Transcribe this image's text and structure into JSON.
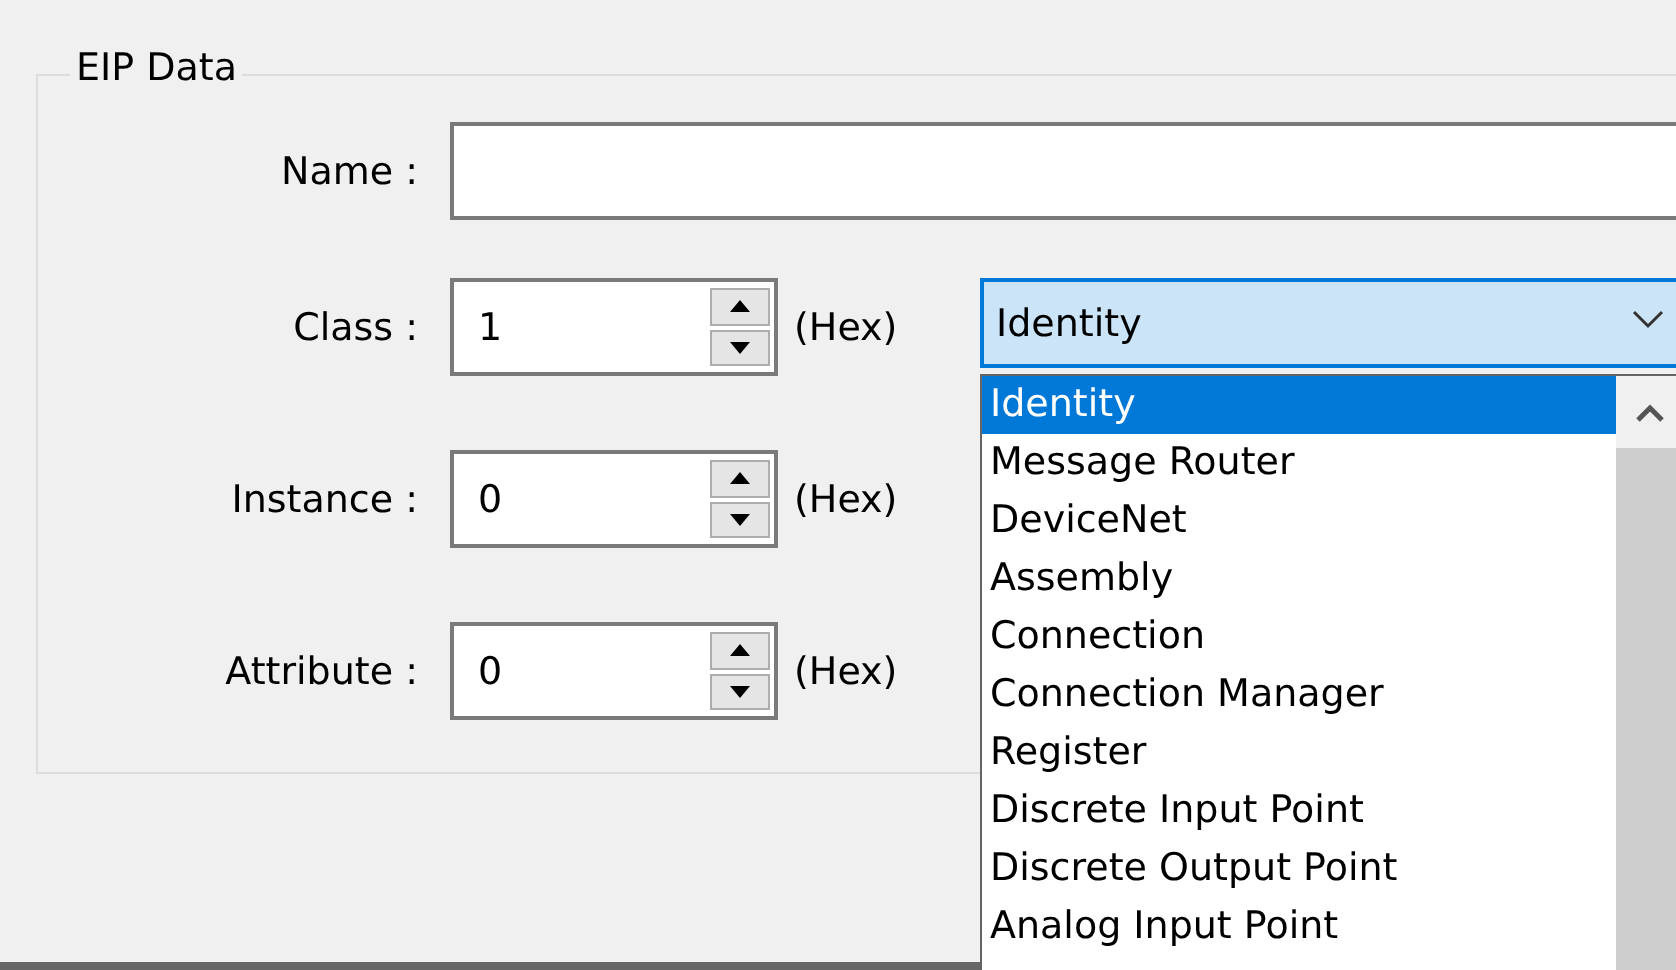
{
  "group": {
    "title": "EIP Data"
  },
  "name_field": {
    "label": "Name :"
  },
  "spin_fields": [
    {
      "label": "Class :",
      "value": "1",
      "unit": "(Hex)"
    },
    {
      "label": "Instance :",
      "value": "0",
      "unit": "(Hex)"
    },
    {
      "label": "Attribute :",
      "value": "0",
      "unit": "(Hex)"
    }
  ],
  "class_dropdown": {
    "value": "Identity",
    "expanded": true,
    "options": [
      {
        "label": "Identity",
        "selected": true
      },
      {
        "label": "Message Router",
        "selected": false
      },
      {
        "label": "DeviceNet",
        "selected": false
      },
      {
        "label": "Assembly",
        "selected": false
      },
      {
        "label": "Connection",
        "selected": false
      },
      {
        "label": "Connection Manager",
        "selected": false
      },
      {
        "label": "Register",
        "selected": false
      },
      {
        "label": "Discrete Input Point",
        "selected": false
      },
      {
        "label": "Discrete Output Point",
        "selected": false
      },
      {
        "label": "Analog Input Point",
        "selected": false
      }
    ]
  }
}
